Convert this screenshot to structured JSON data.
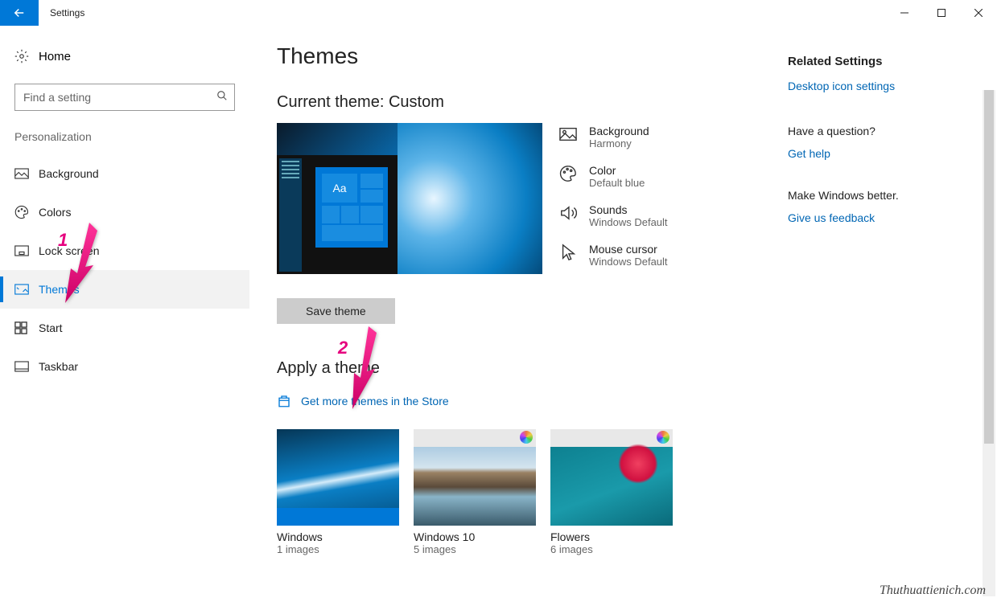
{
  "titlebar": {
    "title": "Settings"
  },
  "sidebar": {
    "home": "Home",
    "search_placeholder": "Find a setting",
    "section": "Personalization",
    "items": [
      {
        "label": "Background"
      },
      {
        "label": "Colors"
      },
      {
        "label": "Lock screen"
      },
      {
        "label": "Themes"
      },
      {
        "label": "Start"
      },
      {
        "label": "Taskbar"
      }
    ]
  },
  "main": {
    "title": "Themes",
    "current_theme_label": "Current theme: Custom",
    "props": {
      "background": {
        "label": "Background",
        "value": "Harmony"
      },
      "color": {
        "label": "Color",
        "value": "Default blue"
      },
      "sounds": {
        "label": "Sounds",
        "value": "Windows Default"
      },
      "mouse": {
        "label": "Mouse cursor",
        "value": "Windows Default"
      }
    },
    "save_button": "Save theme",
    "apply_section": "Apply a theme",
    "store_link": "Get more themes in the Store",
    "themes": [
      {
        "name": "Windows",
        "count": "1 images"
      },
      {
        "name": "Windows 10",
        "count": "5 images"
      },
      {
        "name": "Flowers",
        "count": "6 images"
      }
    ],
    "preview_aa": "Aa"
  },
  "right": {
    "related_header": "Related Settings",
    "desktop_icon_link": "Desktop icon settings",
    "question_header": "Have a question?",
    "get_help_link": "Get help",
    "better_header": "Make Windows better.",
    "feedback_link": "Give us feedback"
  },
  "annotations": {
    "one": "1",
    "two": "2"
  },
  "watermark": "Thuthuattienich.com"
}
